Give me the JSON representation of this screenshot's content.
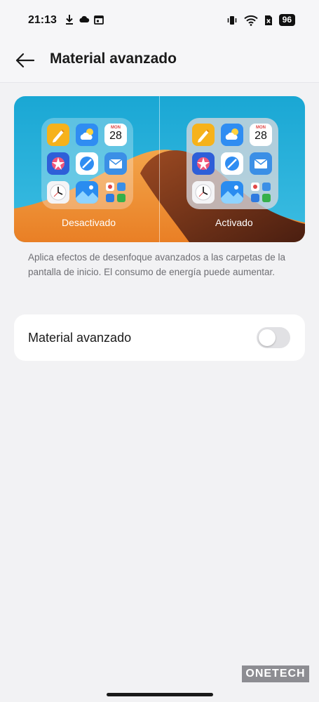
{
  "status_bar": {
    "time": "21:13",
    "battery": "96",
    "left_icons": [
      "download-icon",
      "cloud-icon",
      "calendar-icon"
    ],
    "right_icons": [
      "vibrate-icon",
      "wifi-icon",
      "no-sim-icon",
      "battery-icon"
    ]
  },
  "header": {
    "title": "Material avanzado",
    "back_icon": "arrow-left-icon"
  },
  "preview": {
    "label_off": "Desactivado",
    "label_on": "Activado",
    "calendar_month": "MON",
    "calendar_day": "28"
  },
  "description": "Aplica efectos de desenfoque avanzados a las carpetas de la pantalla de inicio. El consumo de energía puede aumentar.",
  "setting": {
    "label": "Material avanzado",
    "toggle_on": false
  },
  "watermark": "ONETECH",
  "colors": {
    "background": "#f2f2f4",
    "card": "#ffffff",
    "toggle_off": "#e1e1e4",
    "text_primary": "#1a1a1a",
    "text_secondary": "#6e6e73"
  }
}
